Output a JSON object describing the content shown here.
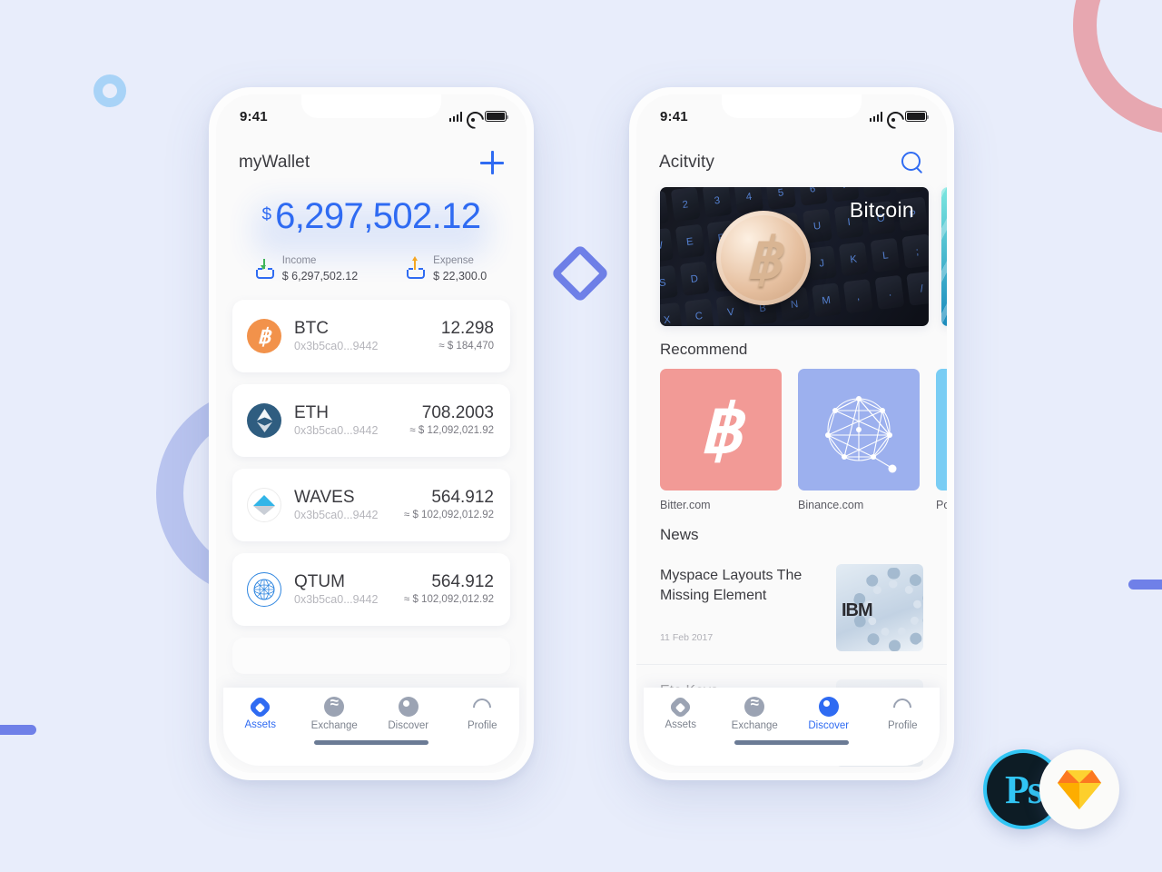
{
  "background": {
    "color": "#e8edfb",
    "decorations": [
      {
        "name": "ring-small",
        "color": "#a8d3f7"
      },
      {
        "name": "ring-large",
        "color": "#b9c4ef"
      },
      {
        "name": "arc-pink",
        "color": "#e7a7b0"
      },
      {
        "name": "diamond-outline",
        "color": "#6f80e8"
      },
      {
        "name": "bar-left",
        "color": "#6f80e8"
      },
      {
        "name": "bar-right",
        "color": "#6f80e8"
      }
    ]
  },
  "accent": "#2f6bf2",
  "phone1": {
    "status_bar": {
      "time": "9:41"
    },
    "header": {
      "title": "myWallet",
      "add_icon": "plus-icon"
    },
    "balance": {
      "currency": "$",
      "amount": "6,297,502.12"
    },
    "summary": [
      {
        "icon": "income-icon",
        "label": "Income",
        "value": "$ 6,297,502.12"
      },
      {
        "icon": "expense-icon",
        "label": "Expense",
        "value": "$ 22,300.0"
      }
    ],
    "wallets": [
      {
        "symbol": "BTC",
        "address": "0x3b5ca0...9442",
        "amount": "12.298",
        "usd": "≈ $ 184,470",
        "icon": "bitcoin-icon",
        "color": "#f2924b"
      },
      {
        "symbol": "ETH",
        "address": "0x3b5ca0...9442",
        "amount": "708.2003",
        "usd": "≈ $ 12,092,021.92",
        "icon": "ethereum-icon",
        "color": "#2f5d80"
      },
      {
        "symbol": "WAVES",
        "address": "0x3b5ca0...9442",
        "amount": "564.912",
        "usd": "≈ $ 102,092,012.92",
        "icon": "waves-icon",
        "color": "#32b5e8"
      },
      {
        "symbol": "QTUM",
        "address": "0x3b5ca0...9442",
        "amount": "564.912",
        "usd": "≈ $ 102,092,012.92",
        "icon": "qtum-icon",
        "color": "#2f86e0"
      }
    ],
    "tabs": [
      {
        "label": "Assets",
        "icon": "assets-icon",
        "active": true
      },
      {
        "label": "Exchange",
        "icon": "exchange-icon",
        "active": false
      },
      {
        "label": "Discover",
        "icon": "discover-icon",
        "active": false
      },
      {
        "label": "Profile",
        "icon": "profile-icon",
        "active": false
      }
    ]
  },
  "phone2": {
    "status_bar": {
      "time": "9:41"
    },
    "header": {
      "title": "Acitvity",
      "search_icon": "search-icon"
    },
    "carousel": [
      {
        "label": "Bitcoin",
        "image": "bitcoin-coin-on-keyboard"
      },
      {
        "label": "",
        "image": "teal-abstract"
      }
    ],
    "recommend": {
      "title": "Recommend",
      "items": [
        {
          "label": "Bitter.com",
          "icon": "bitcoin-icon",
          "color": "#f29a96"
        },
        {
          "label": "Binance.com",
          "icon": "network-graph-icon",
          "color": "#9cb0ee"
        },
        {
          "label": "Poloniex.com",
          "icon": "poloniex-icon",
          "color": "#79cdf4"
        }
      ]
    },
    "news": {
      "title": "News",
      "items": [
        {
          "title": "Myspace Layouts The Missing Element",
          "date": "11 Feb 2017",
          "thumb": "ibm-server-rings"
        },
        {
          "title": "Eta Keys",
          "date": "",
          "thumb": "portrait"
        }
      ]
    },
    "tabs": [
      {
        "label": "Assets",
        "icon": "assets-icon",
        "active": false
      },
      {
        "label": "Exchange",
        "icon": "exchange-icon",
        "active": false
      },
      {
        "label": "Discover",
        "icon": "discover-icon",
        "active": true
      },
      {
        "label": "Profile",
        "icon": "profile-icon",
        "active": false
      }
    ]
  },
  "badges": [
    {
      "name": "photoshop-badge",
      "label": "Ps",
      "color": "#31c5f4"
    },
    {
      "name": "sketch-badge",
      "label": "",
      "color": "#f7a100"
    }
  ]
}
